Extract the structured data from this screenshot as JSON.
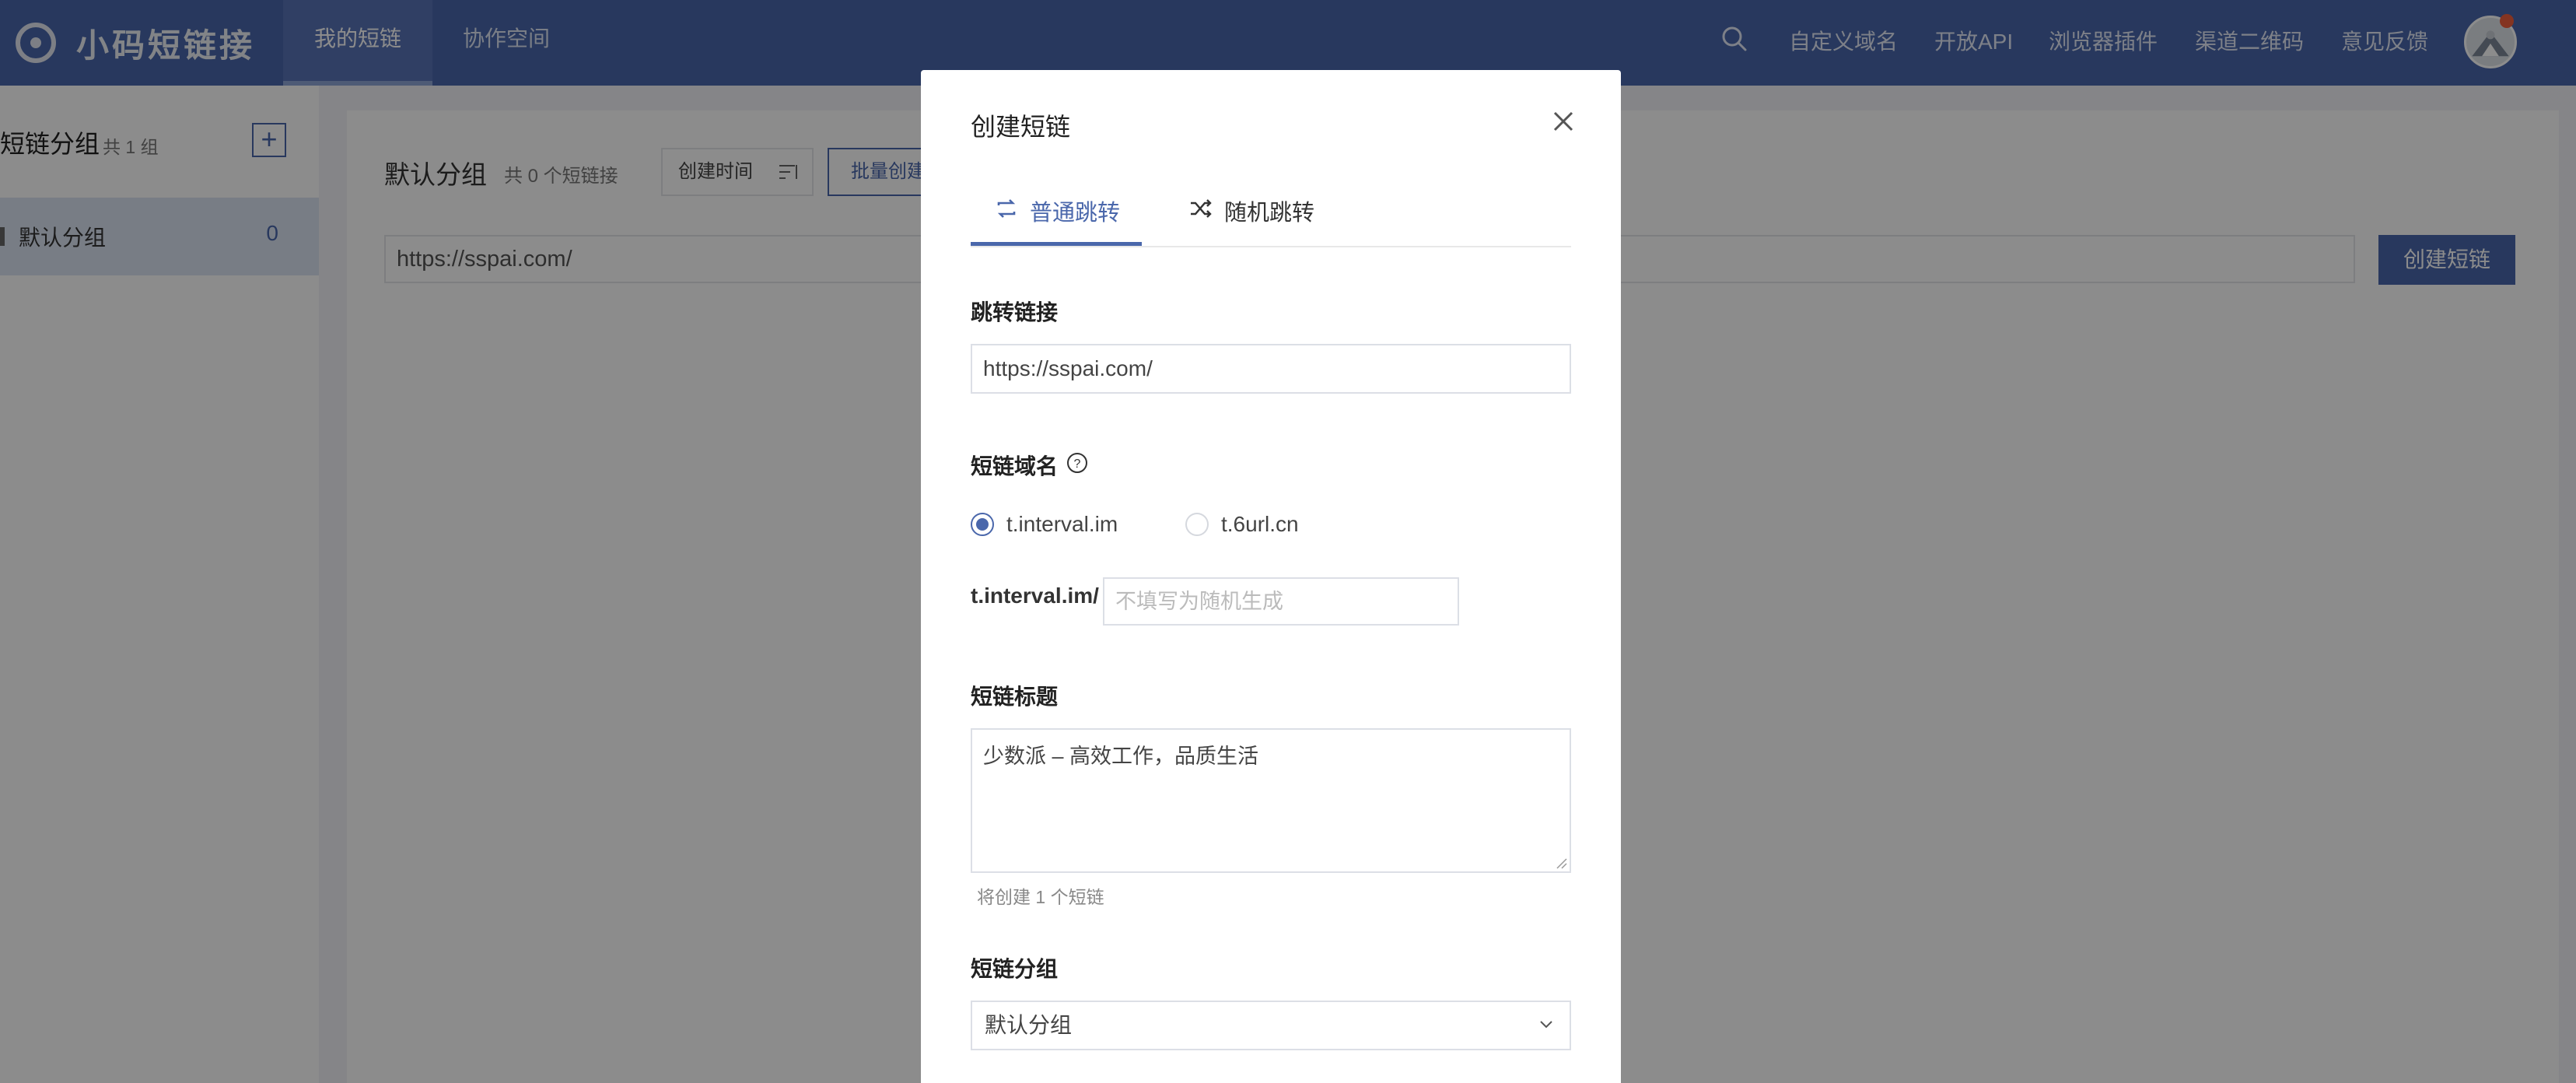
{
  "app": {
    "logo_text": "小码短链接"
  },
  "nav": {
    "tabs": [
      {
        "label": "我的短链",
        "active": true
      },
      {
        "label": "协作空间",
        "active": false
      }
    ],
    "right_links": [
      "自定义域名",
      "开放API",
      "浏览器插件",
      "渠道二维码",
      "意见反馈"
    ],
    "search_icon": "search-icon",
    "avatar_icon": "avatar"
  },
  "sidebar": {
    "title": "短链分组",
    "count": "共 1 组",
    "add_icon": "plus-icon",
    "items": [
      {
        "label": "默认分组",
        "count": "0"
      }
    ]
  },
  "main": {
    "title": "默认分组",
    "subtitle": "共 0 个短链接",
    "sort_label": "创建时间",
    "batch_label": "批量创建",
    "url_value": "https://sspai.com/",
    "create_button": "创建短链"
  },
  "modal": {
    "title": "创建短链",
    "tabs": [
      {
        "label": "普通跳转",
        "active": true,
        "icon": "repeat-icon"
      },
      {
        "label": "随机跳转",
        "active": false,
        "icon": "shuffle-icon"
      }
    ],
    "redirect": {
      "label": "跳转链接",
      "value": "https://sspai.com/"
    },
    "domain": {
      "label": "短链域名",
      "options": [
        {
          "label": "t.interval.im",
          "checked": true
        },
        {
          "label": "t.6url.cn",
          "checked": false
        }
      ],
      "prefix": "t.interval.im/",
      "slug_placeholder": "不填写为随机生成"
    },
    "short_title": {
      "label": "短链标题",
      "value": "少数派 – 高效工作，品质生活",
      "hint": "将创建 1 个短链"
    },
    "group": {
      "label": "短链分组",
      "selected": "默认分组"
    }
  },
  "colors": {
    "primary": "#4a67ab",
    "nav_bg": "#4a67ab",
    "overlay": "rgba(0,0,0,0.45)"
  }
}
